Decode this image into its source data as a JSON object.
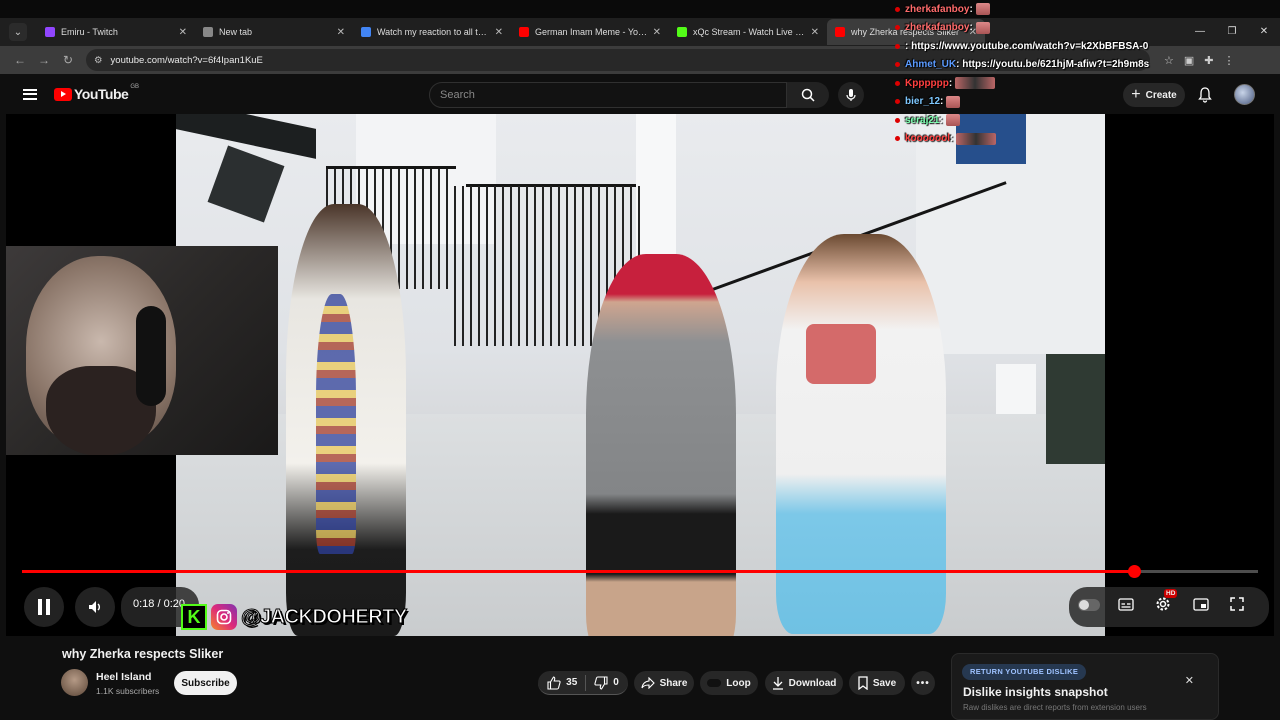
{
  "browser": {
    "tabs": [
      {
        "label": "Emiru - Twitch",
        "color": "#9146ff"
      },
      {
        "label": "New tab",
        "color": "#888888"
      },
      {
        "label": "Watch my reaction to all this | S",
        "color": "#4285f4"
      },
      {
        "label": "German Imam Meme - YouTube",
        "color": "#ff0000"
      },
      {
        "label": "xQc Stream - Watch Live on Kic",
        "color": "#53fc18"
      },
      {
        "label": "why Zherka respects Sliker",
        "color": "#ff0000"
      }
    ],
    "url": "youtube.com/watch?v=6f4Ipan1KuE"
  },
  "youtube": {
    "logo_text": "YouTube",
    "region": "GB",
    "search_placeholder": "Search",
    "create_label": "Create"
  },
  "player": {
    "time": "0:18 / 0:20",
    "progress": 0.9,
    "handle": "@JACKDOHERTY",
    "hd_badge": "HD"
  },
  "chat": [
    {
      "user": "zherkafanboy",
      "color": "#ff6b6b",
      "msg": ":",
      "emote": "small"
    },
    {
      "user": "zherkafanboy",
      "color": "#ff6b6b",
      "msg": ":",
      "emote": "small"
    },
    {
      "user": "",
      "color": "#ffffff",
      "msg": ": https://www.youtube.com/watch?v=k2XbBFBSA-0",
      "emote": "none"
    },
    {
      "user": "Ahmet_UK",
      "color": "#5b9bff",
      "msg": ": https://youtu.be/621hjM-afiw?t=2h9m8s",
      "emote": "none"
    },
    {
      "user": "Kpppppp",
      "color": "#ff4040",
      "msg": ":",
      "emote": "wide"
    },
    {
      "user": "bier_12",
      "color": "#7ec8ff",
      "msg": ":",
      "emote": "small"
    },
    {
      "user": "seraj21",
      "color": "#7cffb0",
      "msg": ":",
      "emote": "small"
    },
    {
      "user": "kooooool",
      "color": "#ff4040",
      "msg": ":",
      "emote": "wide"
    }
  ],
  "video": {
    "title": "why Zherka respects Sliker",
    "channel": "Heel Island",
    "subscribers": "1.1K subscribers",
    "subscribe_label": "Subscribe",
    "likes": "35",
    "dislikes": "0",
    "share_label": "Share",
    "loop_label": "Loop",
    "download_label": "Download",
    "save_label": "Save"
  },
  "dislike_card": {
    "badge": "RETURN YOUTUBE DISLIKE",
    "title": "Dislike insights snapshot",
    "subtitle": "Raw dislikes are direct reports from extension users"
  }
}
